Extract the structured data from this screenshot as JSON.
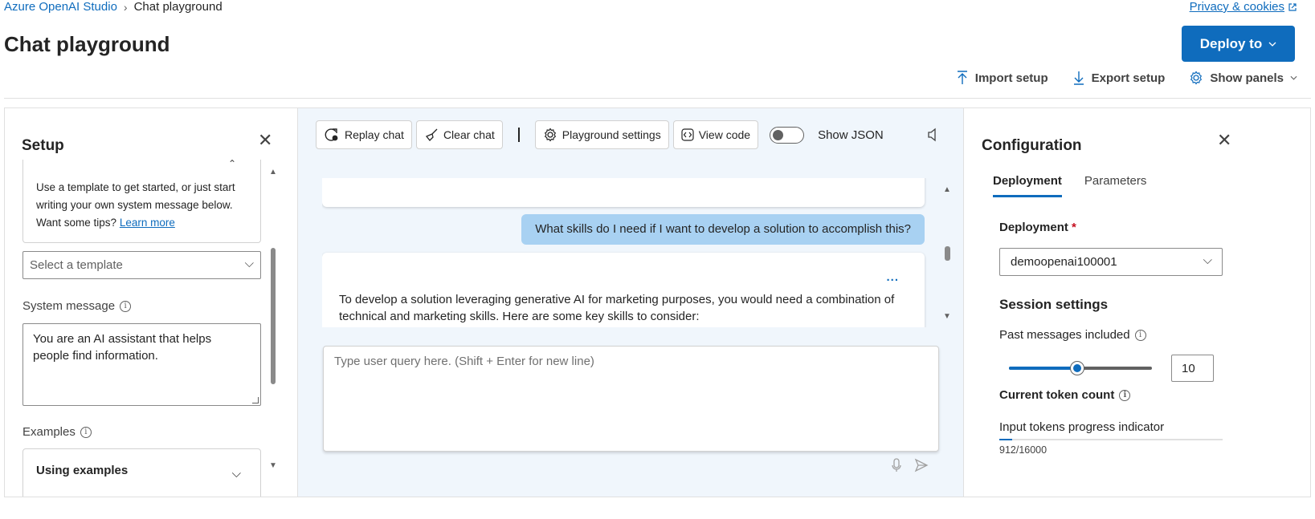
{
  "breadcrumb": {
    "root": "Azure OpenAI Studio",
    "current": "Chat playground"
  },
  "header": {
    "privacy_link": "Privacy & cookies",
    "title": "Chat playground",
    "deploy_label": "Deploy to",
    "toolbar": {
      "import": "Import setup",
      "export": "Export setup",
      "panels": "Show panels"
    }
  },
  "setup": {
    "title": "Setup",
    "tip_text": "Use a template to get started, or just start writing your own system message below. Want some tips?",
    "tip_link": "Learn more",
    "template_placeholder": "Select a template",
    "system_message_label": "System message",
    "system_message": "You are an AI assistant that helps people find information.",
    "examples_label": "Examples",
    "examples_card": "Using examples"
  },
  "chat": {
    "tools": {
      "replay": "Replay chat",
      "clear": "Clear chat",
      "settings": "Playground settings",
      "view_code": "View code",
      "show_json": "Show JSON",
      "show_json_on": false
    },
    "user_message": "What skills do I need if I want to develop a solution to accomplish this?",
    "assistant_message": "To develop a solution leveraging generative AI for marketing purposes, you would need a combination of technical and marketing skills. Here are some key skills to consider:",
    "more_label": "...",
    "query_placeholder": "Type user query here. (Shift + Enter for new line)"
  },
  "config": {
    "title": "Configuration",
    "tabs": [
      {
        "label": "Deployment",
        "active": true
      },
      {
        "label": "Parameters",
        "active": false
      }
    ],
    "deployment_label": "Deployment",
    "required_mark": "*",
    "deployment_value": "demoopenai100001",
    "session_title": "Session settings",
    "past_messages_label": "Past messages included",
    "past_messages_value": "10",
    "past_messages_fraction": 0.48,
    "token_count_label": "Current token count",
    "progress_label": "Input tokens progress indicator",
    "tokens_used": 912,
    "tokens_max": 16000,
    "tokens_text": "912/16000"
  },
  "colors": {
    "accent": "#0f6cbd",
    "user_bubble": "#a8d1f2",
    "chat_bg": "#f0f6fc",
    "required": "#c50f1f"
  },
  "icons": [
    "chevron-right-icon",
    "external-link-icon",
    "chevron-down-icon",
    "import-icon",
    "export-icon",
    "gear-icon",
    "close-icon",
    "info-icon",
    "replay-icon",
    "broom-icon",
    "code-icon",
    "speaker-icon",
    "microphone-icon",
    "send-icon"
  ]
}
